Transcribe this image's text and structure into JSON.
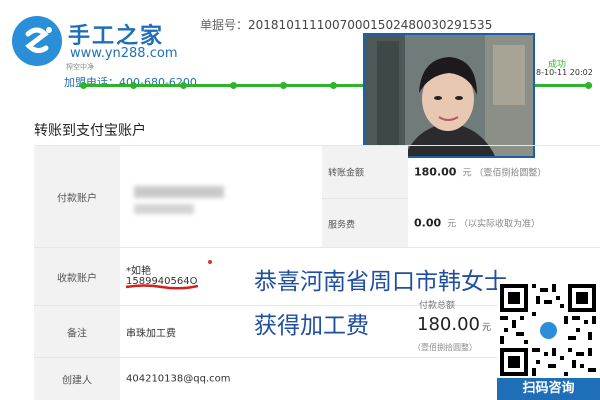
{
  "header": {
    "brand": "手工之家",
    "url": "www.yn288.com",
    "tagline": "搾空中净",
    "phone": "加盟电话：400-680-6200",
    "order_label": "单据号：",
    "order_number": "20181011110070001502480030291535",
    "status": "成功",
    "status_time": "8-10-11 20:02"
  },
  "page": {
    "section_title": "转账到支付宝账户"
  },
  "table": {
    "payer_label": "付款账户",
    "payee_label": "收款账户",
    "payee_name": "*如艳",
    "payee_phone": "1589940564O",
    "note_label": "备注",
    "note_value": "串珠加工费",
    "creator_label": "创建人",
    "creator_value": "404210138@qq.com",
    "amount_label": "转账金额",
    "amount_value": "180.00",
    "amount_unit": "元",
    "amount_note": "（壹佰捌拾圆整）",
    "fee_label": "服务费",
    "fee_value": "0.00",
    "fee_unit": "元",
    "fee_note": "（以实际收取为准）"
  },
  "overlay": {
    "congrats_line1": "恭喜河南省周口市韩女士",
    "congrats_line2": "获得加工费",
    "pay_total_label": "付款总额",
    "pay_total_value": "180.00",
    "pay_total_unit": "元",
    "pay_total_note": "（壹佰捌拾圆整）",
    "qr_caption": "扫码咨询"
  },
  "icons": {
    "logo": "brand-logo-icon",
    "qr": "qr-code-icon"
  },
  "colors": {
    "brand_blue": "#1f6fb8",
    "progress_green": "#2fb32f",
    "congrats_blue": "#1f4fa0"
  }
}
